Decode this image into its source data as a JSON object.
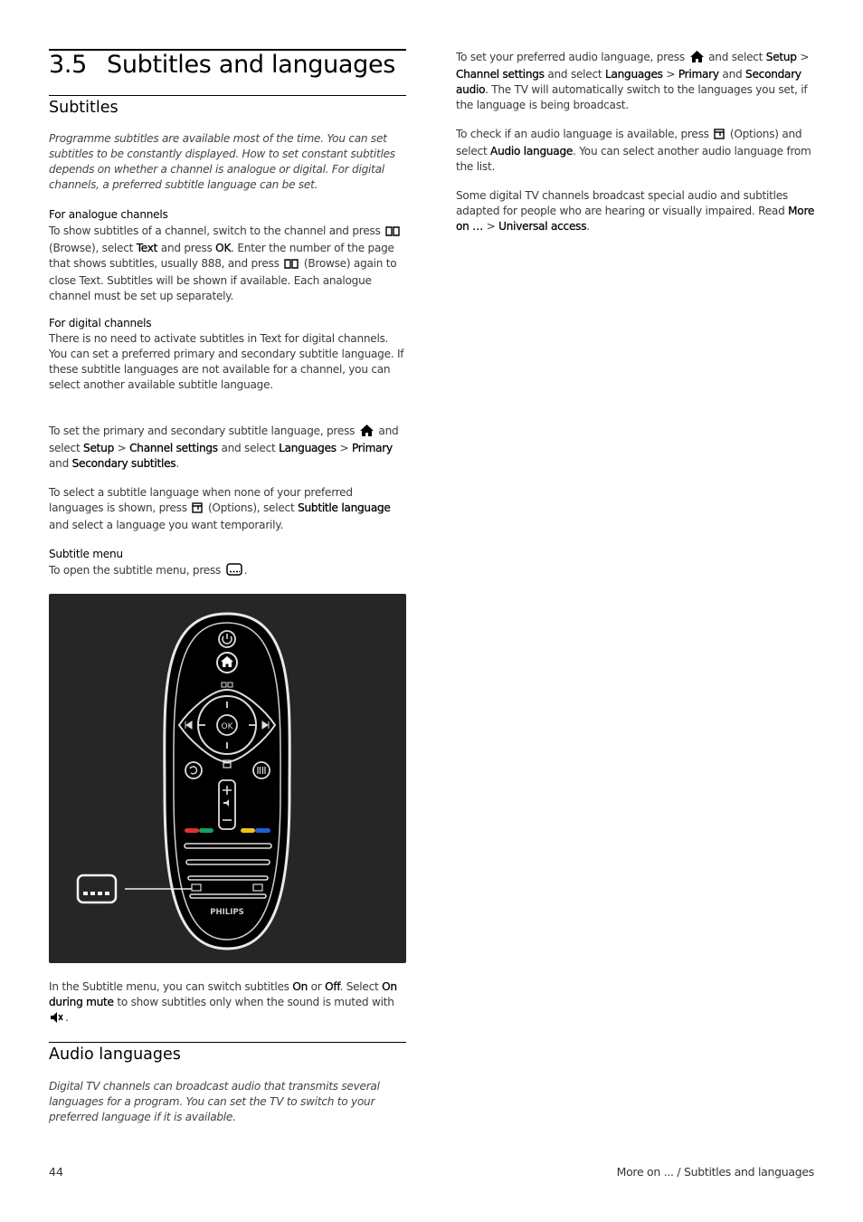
{
  "page": {
    "section_number": "3.5",
    "section_title": "Subtitles and languages",
    "page_number": "44",
    "footer_path": "More on ... / Subtitles and languages"
  },
  "subtitles": {
    "heading": "Subtitles",
    "intro": "Programme subtitles are available most of the time. You can set subtitles to be constantly displayed. How to set constant subtitles depends on whether a channel is analogue or digital. For digital channels, a preferred subtitle language can be set.",
    "analogue": {
      "heading": "For analogue channels",
      "t1": "To show subtitles of a channel, switch to the channel and press",
      "t2": "(Browse), select",
      "b1": "Text",
      "t3": "and press",
      "b2": "OK",
      "t4": ". Enter the number of the page that shows subtitles, usually 888, and press",
      "t5": "(Browse) again to close Text. Subtitles will be shown if available. Each analogue channel must be set up separately."
    },
    "digital": {
      "heading": "For digital channels",
      "text": "There is no need to activate subtitles in Text for digital channels. You can set a preferred primary and secondary subtitle language. If these subtitle languages are not available for a channel, you can select another available subtitle language."
    },
    "set_primary": {
      "t1": "To set the primary and secondary subtitle language, press",
      "t2": "and select",
      "b1": "Setup",
      "sep1": ">",
      "b2": "Channel settings",
      "t3": "and select",
      "b3": "Languages",
      "sep2": ">",
      "b4": "Primary",
      "t4": "and",
      "b5": "Secondary subtitles",
      "t5": "."
    },
    "select_temp": {
      "t1": "To select a subtitle language when none of your preferred languages is shown, press",
      "t2": "(Options), select",
      "b1": "Subtitle language",
      "t3": "and select a language you want temporarily."
    },
    "menu": {
      "heading": "Subtitle menu",
      "t1": "To open the subtitle menu, press",
      "t2": "."
    },
    "menu_info": {
      "t1": "In the Subtitle menu, you can switch subtitles",
      "b1": "On",
      "t2": "or",
      "b2": "Off",
      "t3": ". Select",
      "b3": "On during mute",
      "t4": "to show subtitles only when the sound is muted with",
      "t5": "."
    },
    "figure": {
      "brand": "PHILIPS",
      "ok_label": "OK",
      "callout_icon": "subtitle-icon",
      "color_keys": [
        "#e03030",
        "#1aa060",
        "#f0c020",
        "#2060d0"
      ]
    }
  },
  "audio": {
    "heading": "Audio languages",
    "intro": "Digital TV channels can broadcast audio that transmits several languages for a program. You can set the TV to switch to your preferred language if it is available.",
    "set_pref": {
      "t1": "To set your preferred audio language, press",
      "t2": "and select",
      "b1": "Setup",
      "sep1": ">",
      "b2": "Channel settings",
      "t3": "and select",
      "b3": "Languages",
      "sep2": ">",
      "b4": "Primary",
      "t4": "and",
      "b5": "Secondary audio",
      "t5": ". The TV will automatically switch to the languages you set, if the language is being broadcast."
    },
    "check": {
      "t1": "To check if an audio language is available, press",
      "t2": "(Options) and select",
      "b1": "Audio language",
      "t3": ". You can select another audio language from the list."
    },
    "special": {
      "t1": "Some digital TV channels broadcast special audio and subtitles adapted for people who are hearing or visually impaired. Read",
      "b1": "More on …",
      "sep": ">",
      "b2": "Universal access",
      "t2": "."
    }
  }
}
